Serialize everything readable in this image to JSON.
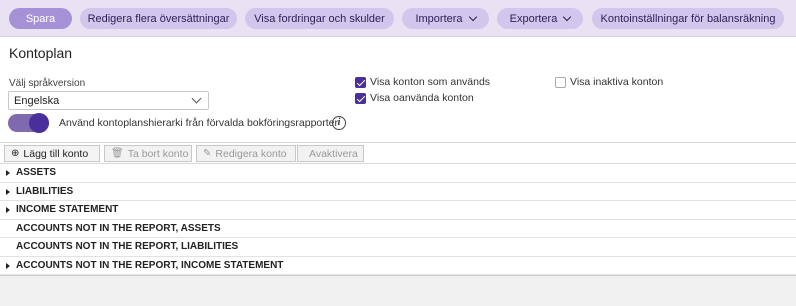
{
  "toolbar": {
    "buttons": [
      {
        "label": "Spara"
      },
      {
        "label": "Redigera flera översättningar"
      },
      {
        "label": "Visa fordringar och skulder"
      },
      {
        "label": "Importera"
      },
      {
        "label": "Exportera"
      },
      {
        "label": "Kontoinställningar för balansräkning"
      }
    ]
  },
  "page": {
    "title": "Kontoplan"
  },
  "language": {
    "label": "Välj språkversion",
    "value": "Engelska"
  },
  "options": {
    "show_used": {
      "label": "Visa konton som används",
      "checked": true
    },
    "show_unused": {
      "label": "Visa oanvända konton",
      "checked": true
    },
    "show_inactive": {
      "label": "Visa inaktiva konton",
      "checked": false
    }
  },
  "hierarchy_toggle": {
    "label": "Använd kontoplanshierarki från förvalda bokföringsrapporter",
    "on": true
  },
  "actions": {
    "add": "Lägg till konto",
    "delete": "Ta bort konto",
    "edit": "Redigera konto",
    "deactivate": "Avaktivera"
  },
  "tree": [
    {
      "label": "ASSETS",
      "expandable": true
    },
    {
      "label": "LIABILITIES",
      "expandable": true
    },
    {
      "label": "INCOME STATEMENT",
      "expandable": true
    },
    {
      "label": "ACCOUNTS NOT IN THE REPORT, ASSETS",
      "expandable": false
    },
    {
      "label": "ACCOUNTS NOT IN THE REPORT, LIABILITIES",
      "expandable": false
    },
    {
      "label": "ACCOUNTS NOT IN THE REPORT, INCOME STATEMENT",
      "expandable": true
    }
  ],
  "colors": {
    "accent": "#4a2f9c",
    "toolbar_bg": "#e8e2f3",
    "button_bg": "#d3c6ec",
    "primary_button": "#a592d6"
  }
}
